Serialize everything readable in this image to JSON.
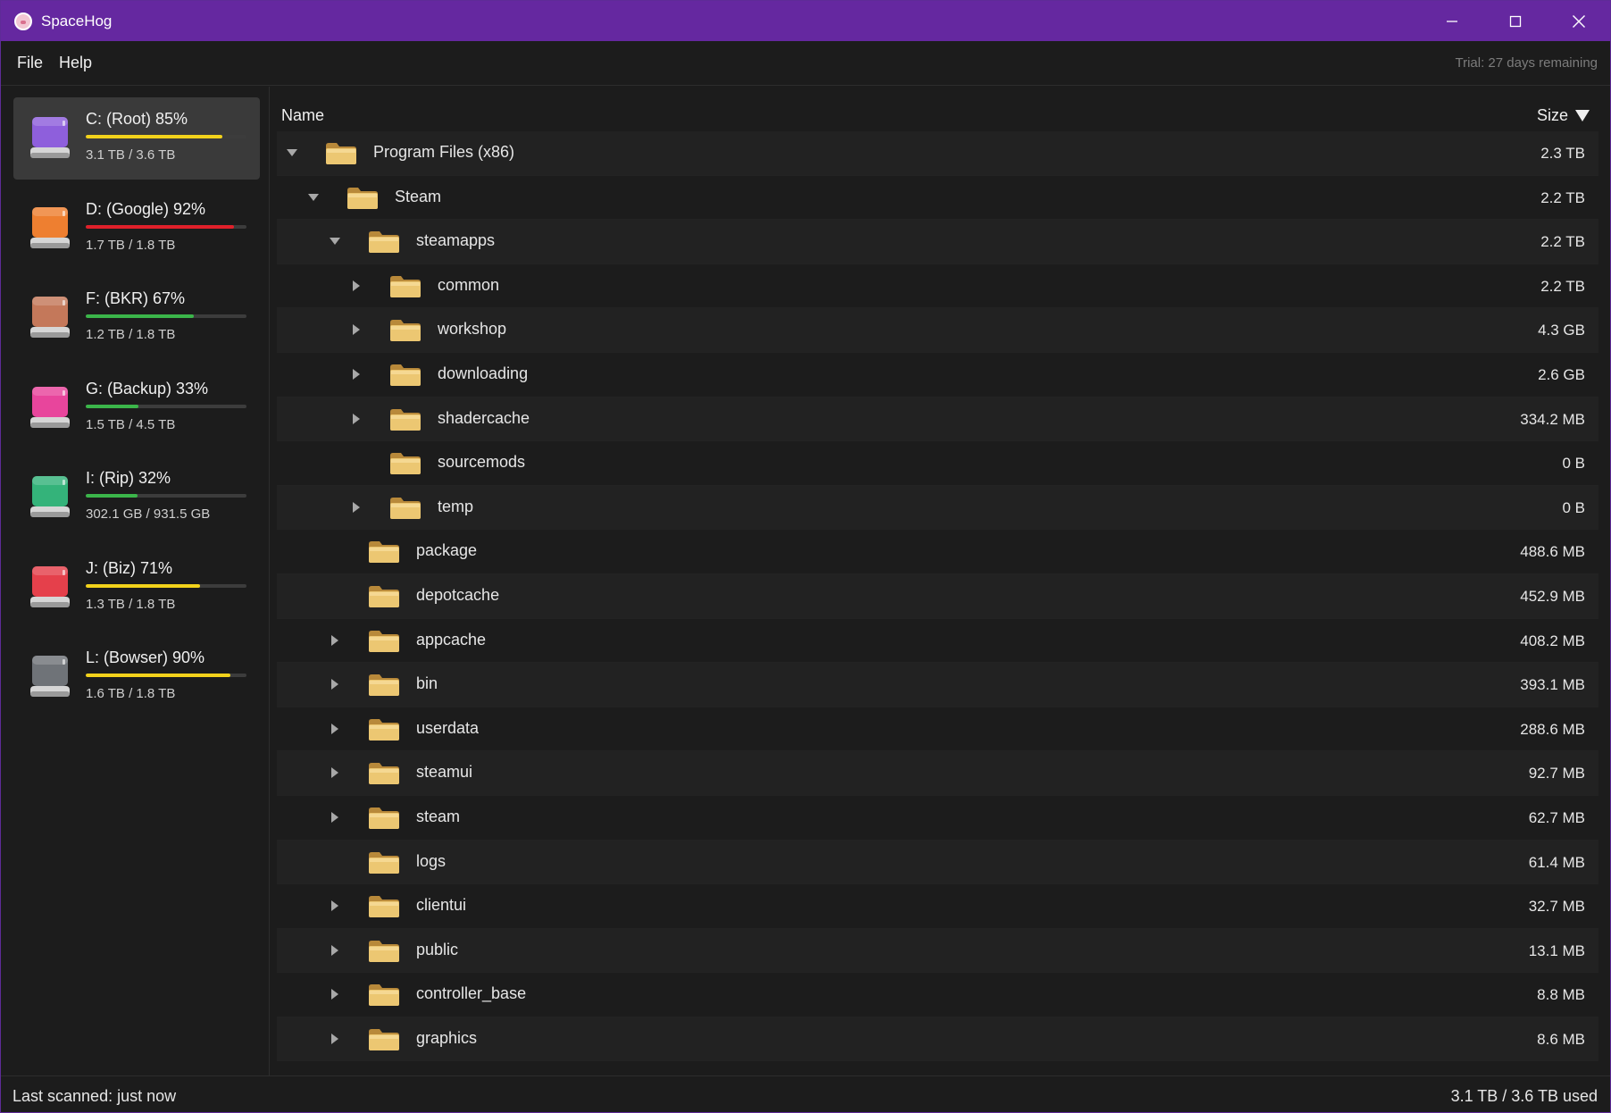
{
  "app": {
    "title": "SpaceHog"
  },
  "menu": {
    "items": [
      "File",
      "Help"
    ],
    "trial": "Trial: 27 days remaining"
  },
  "drives": [
    {
      "name": "C: (Root) 85%",
      "size": "3.1 TB / 3.6 TB",
      "percent": 85,
      "bar_color": "#f2d21b",
      "icon_color": "#8e5fdc",
      "selected": true
    },
    {
      "name": "D: (Google) 92%",
      "size": "1.7 TB / 1.8 TB",
      "percent": 92,
      "bar_color": "#e0202a",
      "icon_color": "#ee7f30",
      "selected": false
    },
    {
      "name": "F: (BKR) 67%",
      "size": "1.2 TB / 1.8 TB",
      "percent": 67,
      "bar_color": "#3bb54a",
      "icon_color": "#c4785a",
      "selected": false
    },
    {
      "name": "G: (Backup) 33%",
      "size": "1.5 TB / 4.5 TB",
      "percent": 33,
      "bar_color": "#3bb54a",
      "icon_color": "#e8459c",
      "selected": false
    },
    {
      "name": "I: (Rip) 32%",
      "size": "302.1 GB / 931.5 GB",
      "percent": 32,
      "bar_color": "#3bb54a",
      "icon_color": "#34b37a",
      "selected": false
    },
    {
      "name": "J: (Biz) 71%",
      "size": "1.3 TB / 1.8 TB",
      "percent": 71,
      "bar_color": "#f2d21b",
      "icon_color": "#e5404b",
      "selected": false
    },
    {
      "name": "L: (Bowser) 90%",
      "size": "1.6 TB / 1.8 TB",
      "percent": 90,
      "bar_color": "#f2d21b",
      "icon_color": "#6f7378",
      "selected": false
    }
  ],
  "columns": {
    "name": "Name",
    "size": "Size"
  },
  "tree": [
    {
      "name": "Program Files (x86)",
      "size": "2.3 TB",
      "depth": 0,
      "expander": "expanded"
    },
    {
      "name": "Steam",
      "size": "2.2 TB",
      "depth": 1,
      "expander": "expanded"
    },
    {
      "name": "steamapps",
      "size": "2.2 TB",
      "depth": 2,
      "expander": "expanded"
    },
    {
      "name": "common",
      "size": "2.2 TB",
      "depth": 3,
      "expander": "collapsed"
    },
    {
      "name": "workshop",
      "size": "4.3 GB",
      "depth": 3,
      "expander": "collapsed"
    },
    {
      "name": "downloading",
      "size": "2.6 GB",
      "depth": 3,
      "expander": "collapsed"
    },
    {
      "name": "shadercache",
      "size": "334.2 MB",
      "depth": 3,
      "expander": "collapsed"
    },
    {
      "name": "sourcemods",
      "size": "0 B",
      "depth": 3,
      "expander": "none"
    },
    {
      "name": "temp",
      "size": "0 B",
      "depth": 3,
      "expander": "collapsed"
    },
    {
      "name": "package",
      "size": "488.6 MB",
      "depth": 2,
      "expander": "none"
    },
    {
      "name": "depotcache",
      "size": "452.9 MB",
      "depth": 2,
      "expander": "none"
    },
    {
      "name": "appcache",
      "size": "408.2 MB",
      "depth": 2,
      "expander": "collapsed"
    },
    {
      "name": "bin",
      "size": "393.1 MB",
      "depth": 2,
      "expander": "collapsed"
    },
    {
      "name": "userdata",
      "size": "288.6 MB",
      "depth": 2,
      "expander": "collapsed"
    },
    {
      "name": "steamui",
      "size": "92.7 MB",
      "depth": 2,
      "expander": "collapsed"
    },
    {
      "name": "steam",
      "size": "62.7 MB",
      "depth": 2,
      "expander": "collapsed"
    },
    {
      "name": "logs",
      "size": "61.4 MB",
      "depth": 2,
      "expander": "none"
    },
    {
      "name": "clientui",
      "size": "32.7 MB",
      "depth": 2,
      "expander": "collapsed"
    },
    {
      "name": "public",
      "size": "13.1 MB",
      "depth": 2,
      "expander": "collapsed"
    },
    {
      "name": "controller_base",
      "size": "8.8 MB",
      "depth": 2,
      "expander": "collapsed"
    },
    {
      "name": "graphics",
      "size": "8.6 MB",
      "depth": 2,
      "expander": "collapsed"
    }
  ],
  "status": {
    "left": "Last scanned: just now",
    "right": "3.1 TB / 3.6 TB used"
  },
  "colors": {
    "titlebar": "#6528a0",
    "folder": "#e8c36a",
    "selected_drive": "#3a3a3a"
  }
}
